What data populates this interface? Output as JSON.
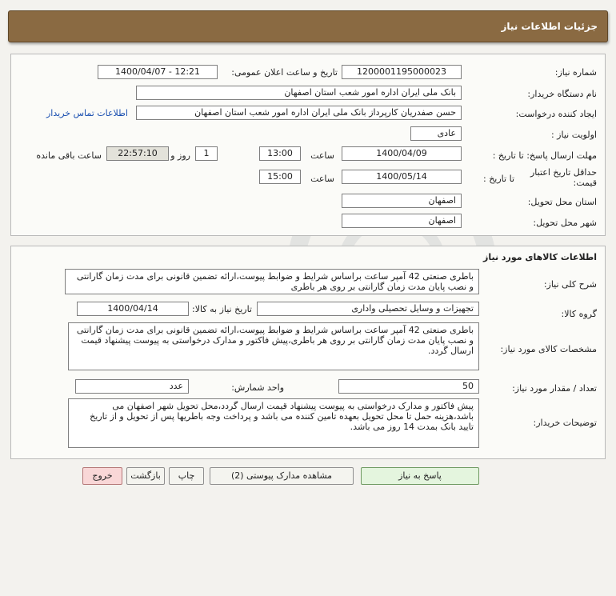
{
  "header": {
    "title": "جزئیات اطلاعات نیاز"
  },
  "info": {
    "need_number_label": "شماره نیاز:",
    "need_number": "1200001195000023",
    "announce_label": "تاریخ و ساعت اعلان عمومی:",
    "announce_value": "1400/04/07 - 12:21",
    "buyer_label": "نام دستگاه خریدار:",
    "buyer": "بانک ملی ایران اداره امور شعب استان اصفهان",
    "creator_label": "ایجاد کننده درخواست:",
    "creator": "حسن صفدریان کارپرداز بانک ملی ایران اداره امور شعب استان اصفهان",
    "contact_link": "اطلاعات تماس خریدار",
    "priority_label": "اولویت نیاز :",
    "priority": "عادی",
    "deadline_label": "مهلت ارسال پاسخ:  تا تاریخ :",
    "deadline_date": "1400/04/09",
    "time_label": "ساعت",
    "deadline_time": "13:00",
    "days_value": "1",
    "days_label": "روز و",
    "remaining_time": "22:57:10",
    "remaining_label": "ساعت باقی مانده",
    "validity_label_1": "حداقل تاریخ اعتبار",
    "validity_label_2": "قیمت:",
    "validity_until": "تا تاریخ :",
    "validity_date": "1400/05/14",
    "validity_time_label": "ساعت",
    "validity_time": "15:00",
    "province_label": "استان محل تحویل:",
    "province": "اصفهان",
    "city_label": "شهر محل تحویل:",
    "city": "اصفهان"
  },
  "goods": {
    "section_title": "اطلاعات کالاهای مورد نیاز",
    "summary_label": "شرح کلی نیاز:",
    "summary": "باطری صنعتی 42 آمپر ساعت براساس شرایط و ضوابط پیوست،ارائه تضمین قانونی برای مدت زمان گارانتی و نصب پایان مدت زمان گارانتی بر روی هر باطری",
    "group_label": "گروه کالا:",
    "group": "تجهیزات و وسایل تحصیلی واداری",
    "need_date_label": "تاریخ نیاز به کالا:",
    "need_date": "1400/04/14",
    "specs_label": "مشخصات کالای مورد نیاز:",
    "specs": "باطری صنعتی 42 آمپر ساعت براساس شرایط و ضوابط پیوست،ارائه تضمین قانونی برای مدت زمان گارانتی و نصب پایان مدت زمان گارانتی بر روی هر باطری،پیش فاکتور و مدارک درخواستی به پیوست پیشنهاد قیمت ارسال گردد.",
    "qty_label": "تعداد / مقدار مورد نیاز:",
    "qty": "50",
    "unit_label": "واحد شمارش:",
    "unit": "عدد",
    "notes_label": "توضیحات خریدار:",
    "notes": "پیش فاکتور و مدارک درخواستی به پیوست پیشنهاد قیمت ارسال گردد،محل تحویل شهر اصفهان می باشد،هزینه حمل تا محل تحویل بعهده تامین کننده می باشد و پرداخت وجه باطریها پس از تحویل و از تاریخ تایید بانک بمدت 14 روز می باشد."
  },
  "buttons": {
    "respond": "پاسخ به نیاز",
    "attachments": "مشاهده مدارک پیوستی (2)",
    "print": "چاپ",
    "back": "بازگشت",
    "exit": "خروج"
  },
  "colors": {
    "header_bg": "#8a6a42",
    "link": "#1a4fb0",
    "exit_bg": "#f9d7d7"
  }
}
